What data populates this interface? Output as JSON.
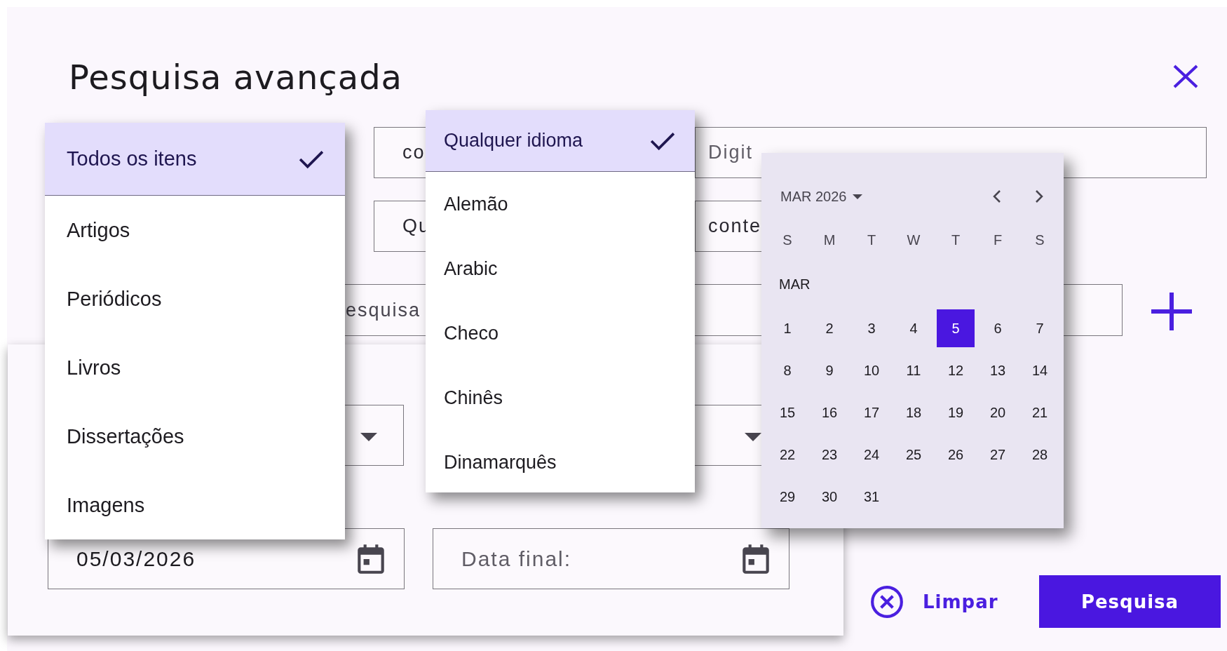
{
  "dialog": {
    "title": "Pesquisa avançada"
  },
  "form": {
    "scope_field": "co",
    "term_field_placeholder": "Digit",
    "language_field": "Qu",
    "condition_field": "conte",
    "second_term_field": "esquisa",
    "start_date": "05/03/2026",
    "end_date_placeholder": "Data final:"
  },
  "item_type_menu": [
    {
      "label": "Todos os itens",
      "selected": true
    },
    {
      "label": "Artigos",
      "selected": false
    },
    {
      "label": "Periódicos",
      "selected": false
    },
    {
      "label": "Livros",
      "selected": false
    },
    {
      "label": "Dissertações",
      "selected": false
    },
    {
      "label": "Imagens",
      "selected": false
    }
  ],
  "language_menu": [
    {
      "label": "Qualquer idioma",
      "selected": true
    },
    {
      "label": "Alemão",
      "selected": false
    },
    {
      "label": "Arabic",
      "selected": false
    },
    {
      "label": "Checo",
      "selected": false
    },
    {
      "label": "Chinês",
      "selected": false
    },
    {
      "label": "Dinamarquês",
      "selected": false
    }
  ],
  "date_picker": {
    "month_button": "MAR 2026",
    "weekdays": [
      "S",
      "M",
      "T",
      "W",
      "T",
      "F",
      "S"
    ],
    "month_label": "MAR",
    "days": [
      {
        "label": "1",
        "selected": false
      },
      {
        "label": "2",
        "selected": false
      },
      {
        "label": "3",
        "selected": false
      },
      {
        "label": "4",
        "selected": false
      },
      {
        "label": "5",
        "selected": true
      },
      {
        "label": "6",
        "selected": false
      },
      {
        "label": "7",
        "selected": false
      },
      {
        "label": "8",
        "selected": false
      },
      {
        "label": "9",
        "selected": false
      },
      {
        "label": "10",
        "selected": false
      },
      {
        "label": "11",
        "selected": false
      },
      {
        "label": "12",
        "selected": false
      },
      {
        "label": "13",
        "selected": false
      },
      {
        "label": "14",
        "selected": false
      },
      {
        "label": "15",
        "selected": false
      },
      {
        "label": "16",
        "selected": false
      },
      {
        "label": "17",
        "selected": false
      },
      {
        "label": "18",
        "selected": false
      },
      {
        "label": "19",
        "selected": false
      },
      {
        "label": "20",
        "selected": false
      },
      {
        "label": "21",
        "selected": false
      },
      {
        "label": "22",
        "selected": false
      },
      {
        "label": "23",
        "selected": false
      },
      {
        "label": "24",
        "selected": false
      },
      {
        "label": "25",
        "selected": false
      },
      {
        "label": "26",
        "selected": false
      },
      {
        "label": "27",
        "selected": false
      },
      {
        "label": "28",
        "selected": false
      },
      {
        "label": "29",
        "selected": false
      },
      {
        "label": "30",
        "selected": false
      },
      {
        "label": "31",
        "selected": false
      }
    ]
  },
  "actions": {
    "clear": "Limpar",
    "search": "Pesquisa"
  }
}
